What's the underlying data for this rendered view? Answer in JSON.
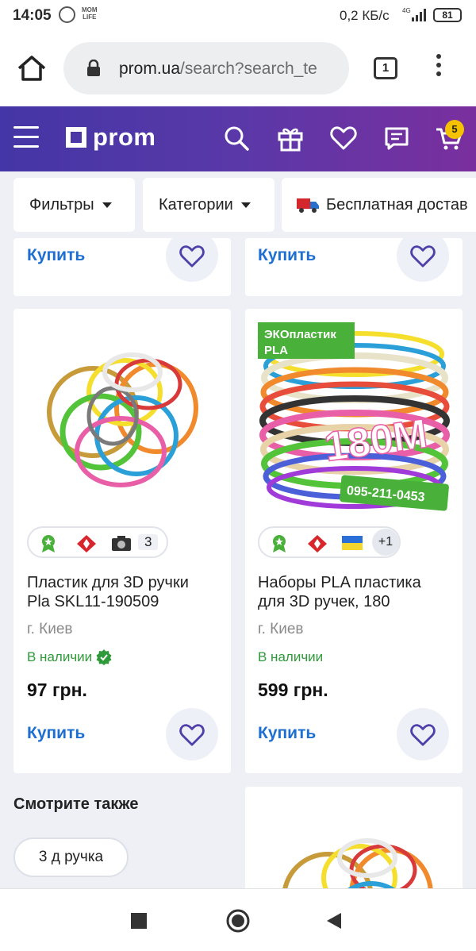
{
  "status": {
    "time": "14:05",
    "mom_label_1": "MOM",
    "mom_label_2": "LIFE",
    "speed": "0,2 КБ/с",
    "net": "4G",
    "battery": "81"
  },
  "browser": {
    "url_host": "prom.ua",
    "url_rest": "/search?search_te",
    "tab_count": "1"
  },
  "header": {
    "logo_text": "prom",
    "cart_count": "5"
  },
  "filters": {
    "filters_label": "Фильтры",
    "categories_label": "Категории",
    "delivery_label": "Бесплатная достав"
  },
  "top_cards": {
    "buy_left": "Купить",
    "buy_right": "Купить"
  },
  "products": [
    {
      "title_line1": "Пластик для 3D ручки",
      "title_line2": "Pla SKL11-190509",
      "city": "г. Киев",
      "stock": "В наличии",
      "price": "97 грн.",
      "buy": "Купить",
      "photo_count": "3"
    },
    {
      "image_text_brand": "ЭКОпластик",
      "image_text_pla": "PLA",
      "image_text_length": "180М",
      "image_text_phone": "095-211-0453",
      "title_line1": "Наборы PLA пластика",
      "title_line2": "для 3D ручек, 180",
      "city": "г. Киев",
      "stock": "В наличии",
      "price": "599 грн.",
      "buy": "Купить",
      "more_badges": "+1"
    }
  ],
  "see_also": {
    "heading": "Смотрите также",
    "tag": "3 д ручка"
  },
  "colors": {
    "accent": "#1d6fd1",
    "header_start": "#4436a6",
    "header_end": "#7a2f9e",
    "in_stock": "#2f9a3a",
    "badge": "#f4c200"
  }
}
